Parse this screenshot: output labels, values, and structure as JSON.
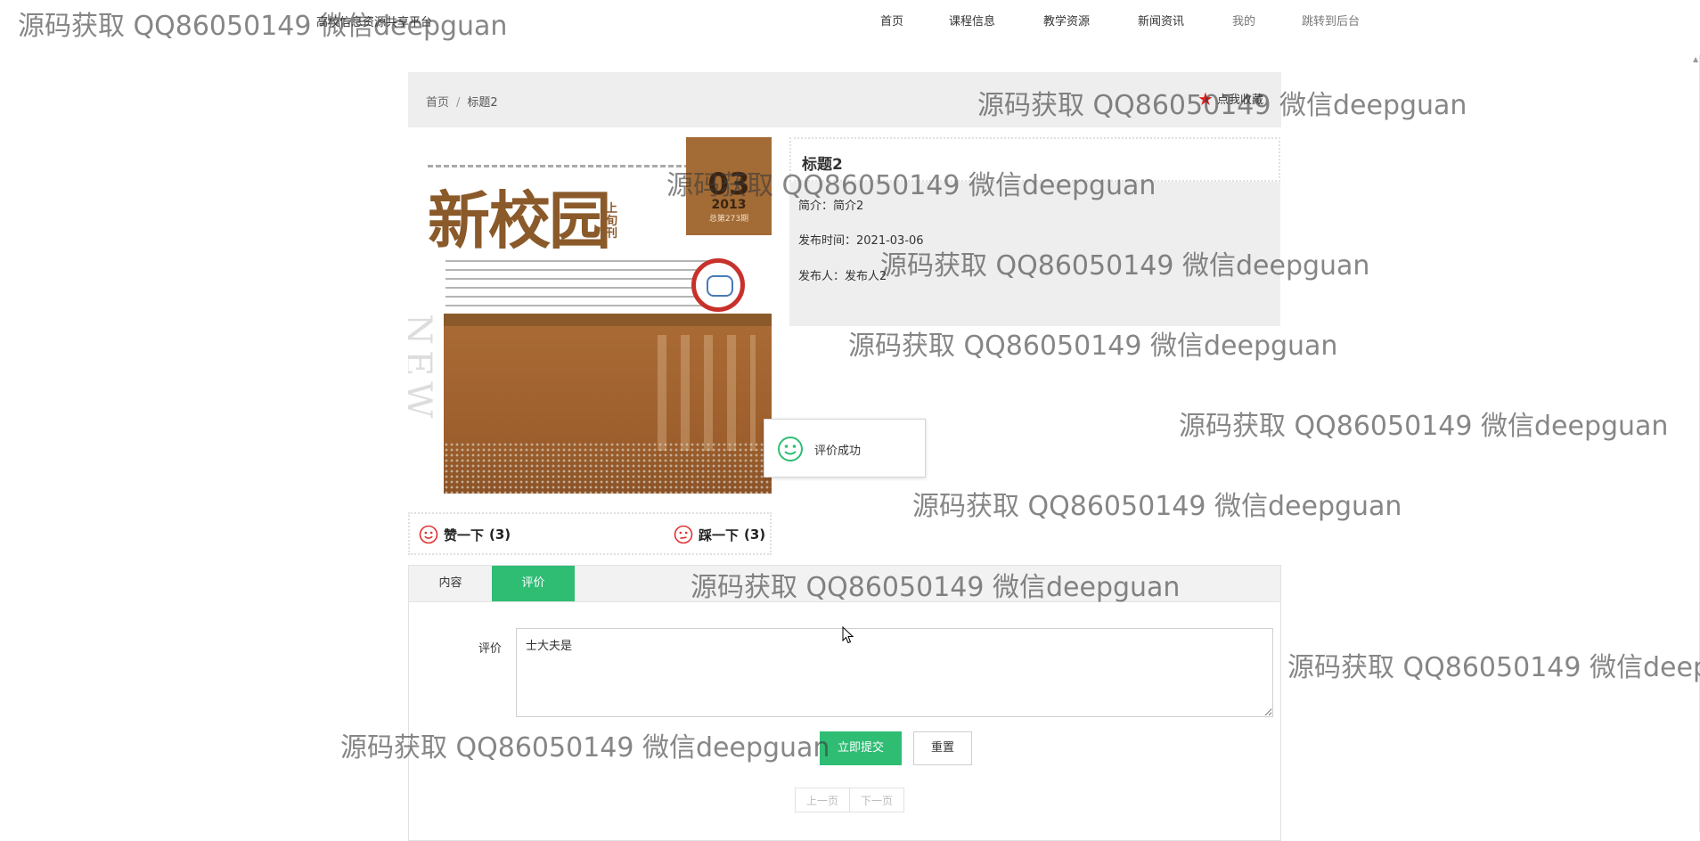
{
  "site": {
    "name": "高校信息资源共享平台",
    "nav": [
      {
        "label": "首页",
        "muted": false
      },
      {
        "label": "课程信息",
        "muted": false
      },
      {
        "label": "教学资源",
        "muted": false
      },
      {
        "label": "新闻资讯",
        "muted": false
      },
      {
        "label": "我的",
        "muted": true
      },
      {
        "label": "跳转到后台",
        "muted": true
      }
    ]
  },
  "breadcrumb": {
    "home": "首页",
    "separator": "/",
    "current": "标题2",
    "favorite_label": "点我收藏",
    "favorite_icon": "star-icon",
    "favorite_color": "#e02020"
  },
  "cover": {
    "magazine_title": "新校园",
    "magazine_sub": "上旬刊",
    "issue_number": "03",
    "year": "2013",
    "volume": "总第273期",
    "side_text": "NEW CAM"
  },
  "detail": {
    "title": "标题2",
    "intro_label": "简介：",
    "intro_value": "简介2",
    "time_label": "发布时间：",
    "time_value": "2021-03-06",
    "publisher_label": "发布人：",
    "publisher_value": "发布人2"
  },
  "toast": {
    "message": "评价成功",
    "icon": "smile-icon",
    "icon_color": "#2fbd74"
  },
  "votes": {
    "like_label": "赞一下",
    "like_count": "(3)",
    "like_icon": "smile-icon",
    "dislike_label": "踩一下",
    "dislike_count": "(3)",
    "dislike_icon": "frown-icon",
    "icon_color": "#e03030"
  },
  "tabs": [
    {
      "label": "内容",
      "active": false
    },
    {
      "label": "评价",
      "active": true
    }
  ],
  "form": {
    "comment_label": "评价",
    "comment_value": "士大夫是",
    "submit_label": "立即提交",
    "reset_label": "重置"
  },
  "pager": {
    "prev_label": "上一页",
    "next_label": "下一页"
  },
  "theme": {
    "accent": "#2fbd74",
    "panel_bg": "#eeeeee"
  },
  "watermark_text": "源码获取 QQ86050149 微信deepguan"
}
